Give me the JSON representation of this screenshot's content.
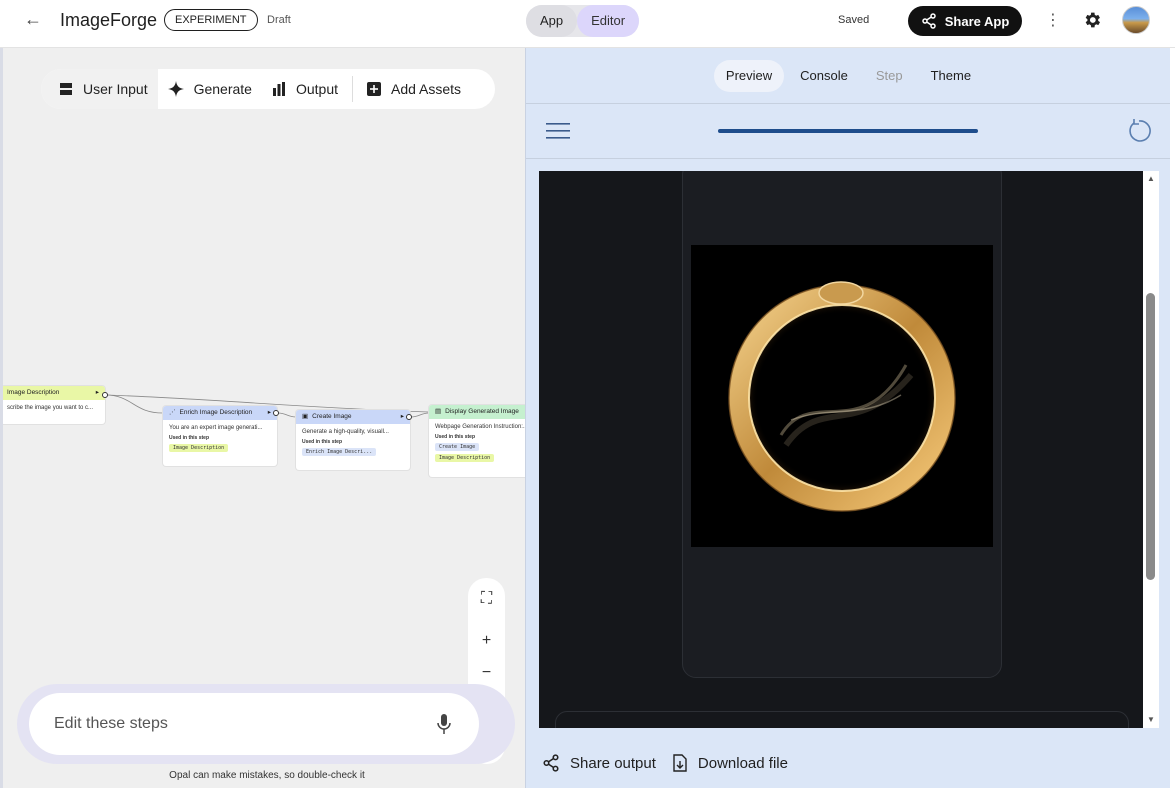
{
  "header": {
    "back_icon": "arrow-left-icon",
    "app_title": "ImageForge",
    "badge": "EXPERIMENT",
    "status": "Draft",
    "mode_app": "App",
    "mode_editor": "Editor",
    "save_state": "Saved",
    "share_label": "Share App"
  },
  "toolbar": {
    "items": [
      "User Input",
      "Generate",
      "Output",
      "Add Assets"
    ]
  },
  "nodes": {
    "image_description": {
      "title": "Image Description",
      "body": "scribe the image you want to c..."
    },
    "enrich": {
      "title": "Enrich Image Description",
      "body": "You are an expert image generati...",
      "used": "Used in this step",
      "chips": [
        "Image Description"
      ]
    },
    "create": {
      "title": "Create Image",
      "body": "Generate a high-quality, visuall...",
      "used": "Used in this step",
      "chips": [
        "Enrich Image Descri..."
      ]
    },
    "display": {
      "title": "Display Generated Image",
      "body": "Webpage Generation Instruction:...",
      "used": "Used in this step",
      "chips": [
        "Create Image",
        "Image Description"
      ]
    }
  },
  "prompt": {
    "placeholder": "Edit these steps",
    "disclaimer": "Opal can make mistakes, so double-check it"
  },
  "preview": {
    "tabs": [
      "Preview",
      "Console",
      "Step",
      "Theme"
    ],
    "active_tab": "Preview",
    "disabled_tab": "Step",
    "share_output": "Share output",
    "download_file": "Download file"
  },
  "colors": {
    "node_input": "#e9f7a6",
    "node_generate": "#c9d7f8",
    "node_output": "#c5f0cf",
    "editor_mode": "#dcd6fb",
    "preview_bg": "#dbe6f7",
    "progress": "#1e4d8c"
  }
}
